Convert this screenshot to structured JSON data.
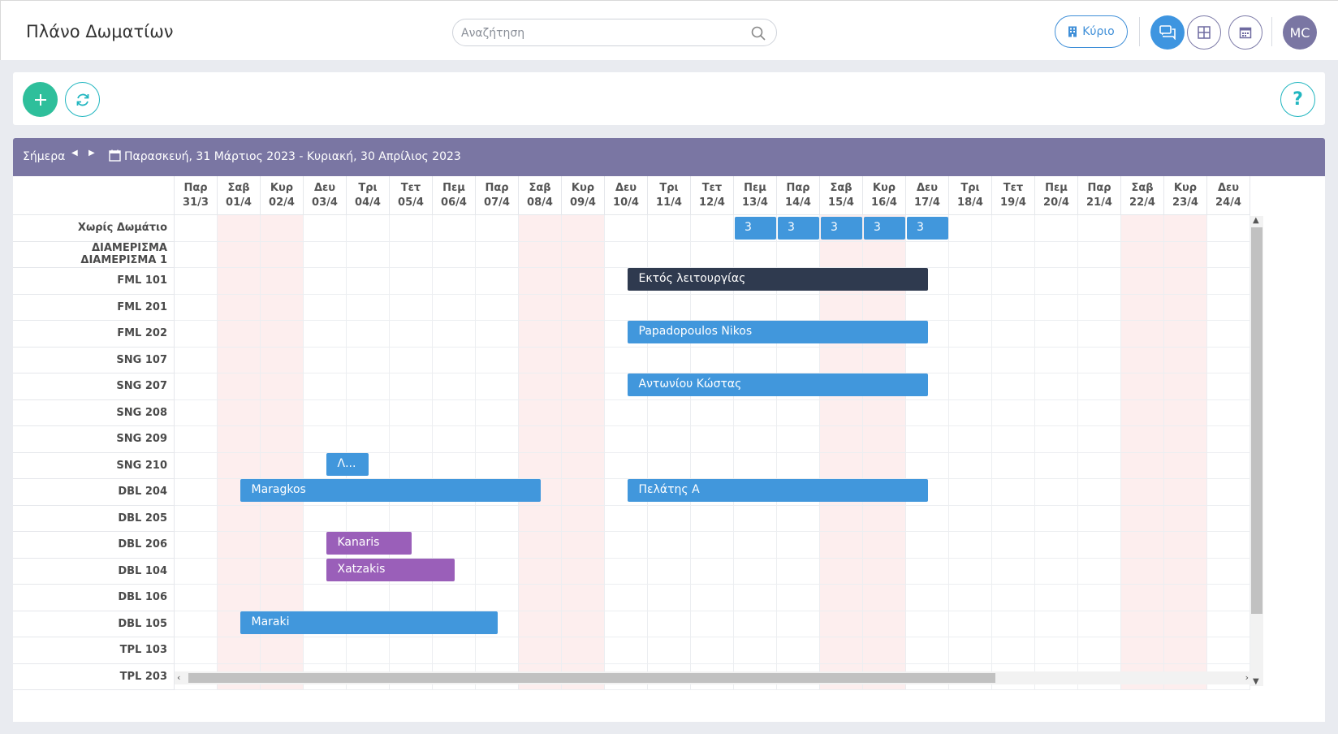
{
  "header": {
    "title": "Πλάνο Δωματίων",
    "search_placeholder": "Αναζήτηση",
    "property_button": "Κύριο",
    "avatar_initials": "MC"
  },
  "planner": {
    "today_label": "Σήμερα",
    "date_range": "Παρασκευή, 31 Μάρτιος 2023 - Κυριακή, 30 Απρίλιος 2023",
    "days": [
      {
        "dow": "Παρ",
        "date": "31/3",
        "weekend": false
      },
      {
        "dow": "Σαβ",
        "date": "01/4",
        "weekend": true
      },
      {
        "dow": "Κυρ",
        "date": "02/4",
        "weekend": true
      },
      {
        "dow": "Δευ",
        "date": "03/4",
        "weekend": false
      },
      {
        "dow": "Τρι",
        "date": "04/4",
        "weekend": false
      },
      {
        "dow": "Τετ",
        "date": "05/4",
        "weekend": false
      },
      {
        "dow": "Πεμ",
        "date": "06/4",
        "weekend": false
      },
      {
        "dow": "Παρ",
        "date": "07/4",
        "weekend": false
      },
      {
        "dow": "Σαβ",
        "date": "08/4",
        "weekend": true
      },
      {
        "dow": "Κυρ",
        "date": "09/4",
        "weekend": true
      },
      {
        "dow": "Δευ",
        "date": "10/4",
        "weekend": false
      },
      {
        "dow": "Τρι",
        "date": "11/4",
        "weekend": false
      },
      {
        "dow": "Τετ",
        "date": "12/4",
        "weekend": false
      },
      {
        "dow": "Πεμ",
        "date": "13/4",
        "weekend": false
      },
      {
        "dow": "Παρ",
        "date": "14/4",
        "weekend": false
      },
      {
        "dow": "Σαβ",
        "date": "15/4",
        "weekend": true
      },
      {
        "dow": "Κυρ",
        "date": "16/4",
        "weekend": true
      },
      {
        "dow": "Δευ",
        "date": "17/4",
        "weekend": false
      },
      {
        "dow": "Τρι",
        "date": "18/4",
        "weekend": false
      },
      {
        "dow": "Τετ",
        "date": "19/4",
        "weekend": false
      },
      {
        "dow": "Πεμ",
        "date": "20/4",
        "weekend": false
      },
      {
        "dow": "Παρ",
        "date": "21/4",
        "weekend": false
      },
      {
        "dow": "Σαβ",
        "date": "22/4",
        "weekend": true
      },
      {
        "dow": "Κυρ",
        "date": "23/4",
        "weekend": true
      },
      {
        "dow": "Δευ",
        "date": "24/4",
        "weekend": false
      }
    ],
    "rooms": [
      "Χωρίς Δωμάτιο",
      "ΔΙΑΜΕΡΙΣΜΑ ΔΙΑΜΕΡΙΣΜΑ 1",
      "FML 101",
      "FML 201",
      "FML 202",
      "SNG 107",
      "SNG 207",
      "SNG 208",
      "SNG 209",
      "SNG 210",
      "DBL 204",
      "DBL 205",
      "DBL 206",
      "DBL 104",
      "DBL 106",
      "DBL 105",
      "TPL 103",
      "TPL 203"
    ],
    "unassigned_counts": [
      {
        "day": 13,
        "count": "3"
      },
      {
        "day": 14,
        "count": "3"
      },
      {
        "day": 15,
        "count": "3"
      },
      {
        "day": 16,
        "count": "3"
      },
      {
        "day": 17,
        "count": "3"
      }
    ],
    "bookings": [
      {
        "room": 2,
        "start": 10.5,
        "end": 17.5,
        "label": "Εκτός λειτουργίας",
        "color": "dark"
      },
      {
        "room": 4,
        "start": 10.5,
        "end": 17.5,
        "label": "Papadopoulos Nikos",
        "color": "blue"
      },
      {
        "room": 6,
        "start": 10.5,
        "end": 17.5,
        "label": "Αντωνίου Κώστας",
        "color": "blue"
      },
      {
        "room": 9,
        "start": 3.5,
        "end": 4.5,
        "label": "Λ...",
        "color": "blue"
      },
      {
        "room": 10,
        "start": 1.5,
        "end": 8.5,
        "label": "Maragkos",
        "color": "blue"
      },
      {
        "room": 10,
        "start": 10.5,
        "end": 17.5,
        "label": "Πελάτης Α",
        "color": "blue"
      },
      {
        "room": 12,
        "start": 3.5,
        "end": 5.5,
        "label": "Kanaris",
        "color": "purple"
      },
      {
        "room": 13,
        "start": 3.5,
        "end": 6.5,
        "label": "Xatzakis",
        "color": "purple"
      },
      {
        "room": 15,
        "start": 1.5,
        "end": 7.5,
        "label": "Maraki",
        "color": "blue"
      }
    ],
    "colors": {
      "blue": "#4197dc",
      "dark": "#2f3a4f",
      "purple": "#9a5fb9",
      "header": "#7a76a3",
      "weekend": "#fdeeee"
    }
  }
}
